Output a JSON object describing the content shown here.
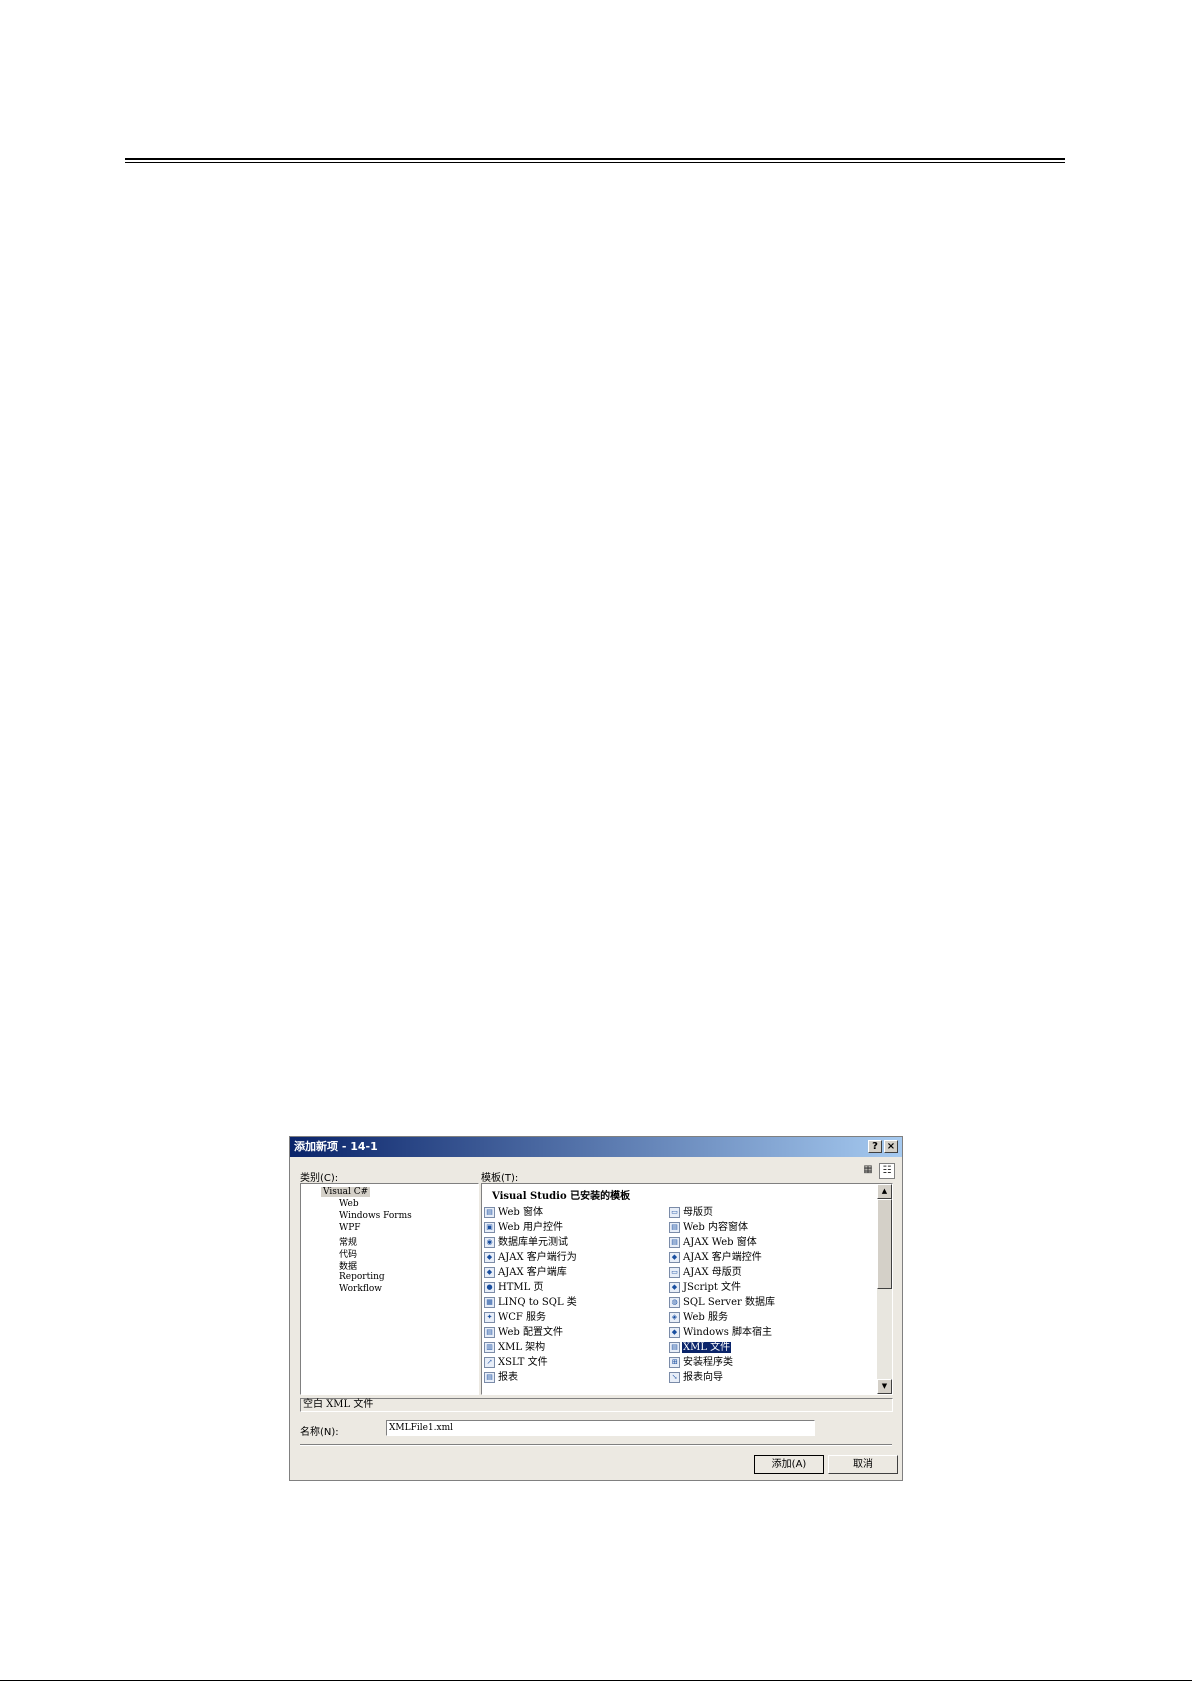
{
  "dialog": {
    "title": "添加新项 - 14-1",
    "help_glyph": "?",
    "close_glyph": "×",
    "category_label": "类别(C):",
    "template_label": "模板(T):",
    "categories": {
      "root": "Visual C#",
      "children": [
        "Web",
        "Windows Forms",
        "WPF",
        "常规",
        "代码",
        "数据",
        "Reporting",
        "Workflow"
      ]
    },
    "template_header": "Visual Studio 已安装的模板",
    "templates_left": [
      "Web 窗体",
      "Web 用户控件",
      "数据库单元测试",
      "AJAX 客户端行为",
      "AJAX 客户端库",
      "HTML 页",
      "LINQ to SQL 类",
      "WCF 服务",
      "Web 配置文件",
      "XML 架构",
      "XSLT 文件",
      "报表"
    ],
    "templates_right": [
      "母版页",
      "Web 内容窗体",
      "AJAX Web 窗体",
      "AJAX 客户端控件",
      "AJAX 母版页",
      "JScript 文件",
      "SQL Server 数据库",
      "Web 服务",
      "Windows 脚本宿主",
      "XML 文件",
      "安装程序类",
      "报表向导"
    ],
    "selected_template": "XML 文件",
    "description": "空白 XML 文件",
    "name_label": "名称(N):",
    "name_value": "XMLFile1.xml",
    "add_button": "添加(A)",
    "cancel_button": "取消"
  }
}
